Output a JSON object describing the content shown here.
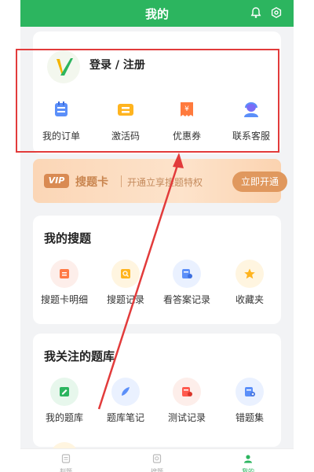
{
  "header": {
    "title": "我的"
  },
  "profile": {
    "login_label": "登录 / 注册"
  },
  "quick_actions": [
    {
      "label": "我的订单",
      "icon": "order-icon"
    },
    {
      "label": "激活码",
      "icon": "activation-code-icon"
    },
    {
      "label": "优惠券",
      "icon": "coupon-icon"
    },
    {
      "label": "联系客服",
      "icon": "customer-service-icon"
    }
  ],
  "vip": {
    "badge": "VIP",
    "name": "搜题卡",
    "desc": "开通立享搜题特权",
    "button": "立即开通"
  },
  "my_search": {
    "title": "我的搜题",
    "items": [
      {
        "label": "搜题卡明细",
        "icon": "card-detail-icon"
      },
      {
        "label": "搜题记录",
        "icon": "search-record-icon"
      },
      {
        "label": "看答案记录",
        "icon": "answer-record-icon"
      },
      {
        "label": "收藏夹",
        "icon": "star-icon"
      }
    ]
  },
  "followed_banks": {
    "title": "我关注的题库",
    "items": [
      {
        "label": "我的题库",
        "icon": "my-bank-icon"
      },
      {
        "label": "题库笔记",
        "icon": "note-icon"
      },
      {
        "label": "测试记录",
        "icon": "test-record-icon"
      },
      {
        "label": "错题集",
        "icon": "wrong-set-icon"
      }
    ]
  },
  "tabbar": {
    "items": [
      {
        "label": "判题",
        "icon": "judge-icon"
      },
      {
        "label": "搜题",
        "icon": "search-tab-icon"
      },
      {
        "label": "我的",
        "icon": "profile-icon"
      }
    ]
  },
  "colors": {
    "brand": "#2cb55f",
    "annotation": "#e23b3b",
    "vip": "#e0985e"
  }
}
